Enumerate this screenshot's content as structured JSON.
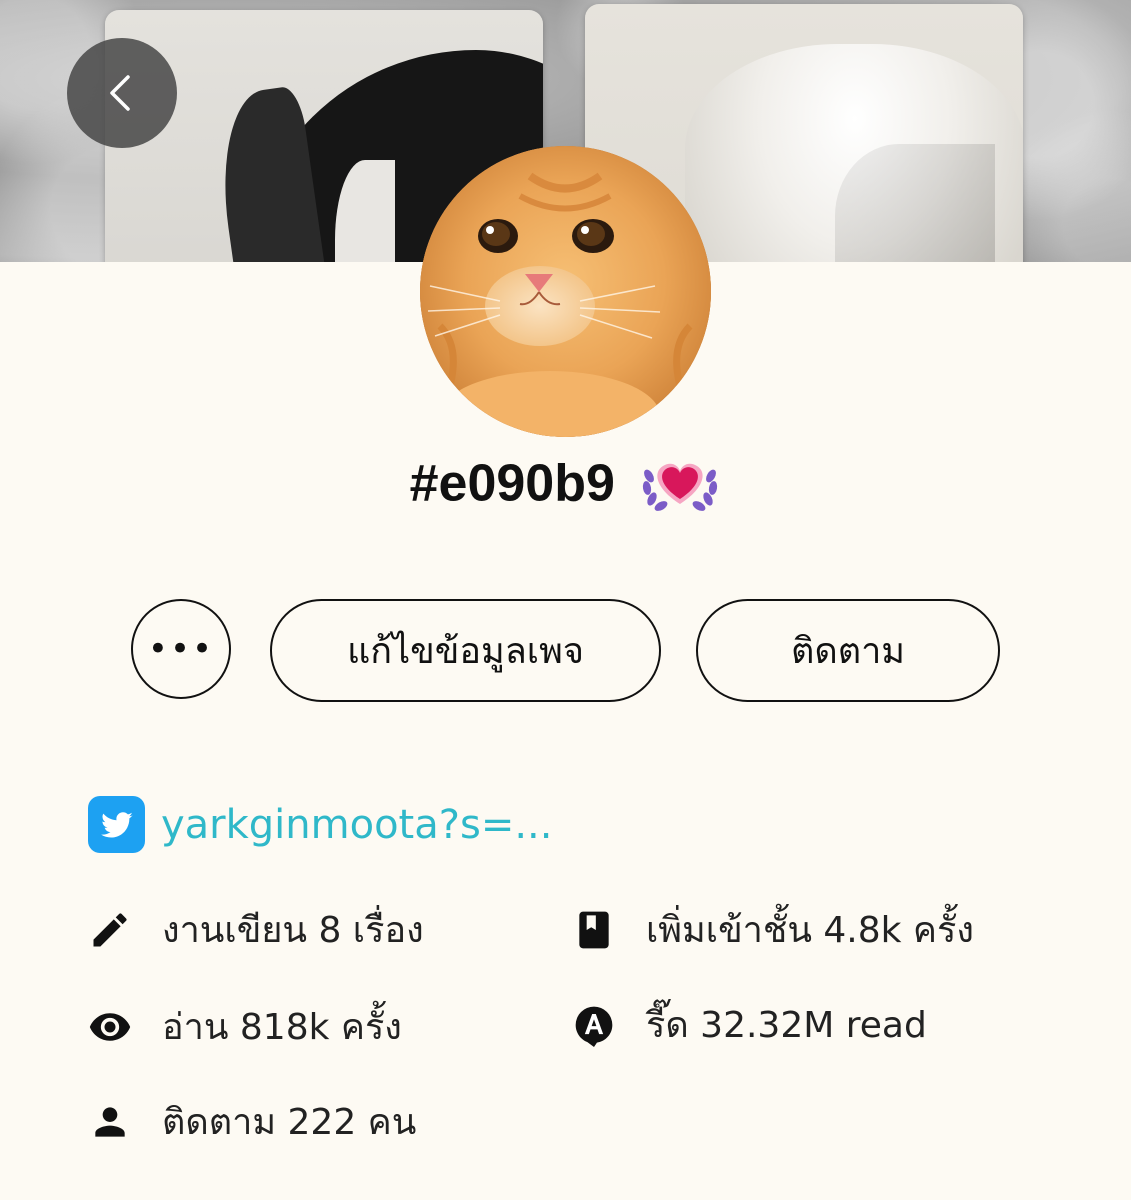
{
  "profile": {
    "name": "#e090b9",
    "badge_icon": "heart-laurel-badge-icon"
  },
  "nav": {
    "back_icon": "chevron-left-icon"
  },
  "actions": {
    "more_label": "•••",
    "edit_label": "แก้ไขข้อมูลเพจ",
    "follow_label": "ติดตาม"
  },
  "social": {
    "icon": "twitter-icon",
    "handle": "yarkginmoota?s=...",
    "brand_color": "#1da1f2",
    "link_color": "#2fb8c9"
  },
  "stats": {
    "works": {
      "icon": "pencil-icon",
      "text": "งานเขียน 8 เรื่อง"
    },
    "reads": {
      "icon": "eye-icon",
      "text": "อ่าน 818k ครั้ง"
    },
    "followers": {
      "icon": "person-icon",
      "text": "ติดตาม 222 คน"
    },
    "shelf": {
      "icon": "bookmark-book-icon",
      "text": "เพิ่มเข้าชั้น 4.8k ครั้ง"
    },
    "react": {
      "icon": "reaction-a-icon",
      "text": "รี๊ด 32.32M read"
    }
  },
  "colors": {
    "background": "#fdfaf3",
    "text": "#111111"
  }
}
